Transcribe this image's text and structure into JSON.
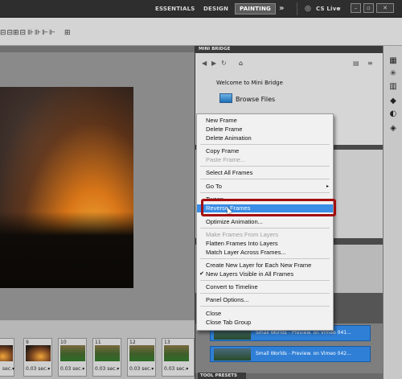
{
  "appbar": {
    "workspaces": [
      "ESSENTIALS",
      "DESIGN",
      "PAINTING"
    ],
    "more": "»",
    "cslive": "CS Live",
    "cslive_arrow": "▾"
  },
  "bridge": {
    "title": "MINI BRIDGE",
    "welcome": "Welcome to Mini Bridge",
    "browse": "Browse Files"
  },
  "menu": {
    "items": [
      {
        "label": "New Frame"
      },
      {
        "label": "Delete Frame"
      },
      {
        "label": "Delete Animation"
      },
      {
        "label": "Copy Frame"
      },
      {
        "label": "Paste Frame..."
      },
      {
        "label": "Select All Frames"
      },
      {
        "label": "Go To"
      },
      {
        "label": "Tween..."
      },
      {
        "label": "Reverse Frames"
      },
      {
        "label": "Optimize Animation..."
      },
      {
        "label": "Make Frames From Layers"
      },
      {
        "label": "Flatten Frames Into Layers"
      },
      {
        "label": "Match Layer Across Frames..."
      },
      {
        "label": "Create New Layer for Each New Frame"
      },
      {
        "label": "New Layers Visible in All Frames"
      },
      {
        "label": "Convert to Timeline"
      },
      {
        "label": "Panel Options..."
      },
      {
        "label": "Close"
      },
      {
        "label": "Close Tab Group"
      }
    ],
    "submenu_arrow": "▸",
    "checkmark": "✔"
  },
  "filmstrip": {
    "frames": [
      {
        "num": "",
        "time": "sec.▾"
      },
      {
        "num": "9",
        "time": "0.03 sec.▾"
      },
      {
        "num": "10",
        "time": "0.03 sec.▾"
      },
      {
        "num": "11",
        "time": "0.03 sec.▾"
      },
      {
        "num": "12",
        "time": "0.03 sec.▾"
      },
      {
        "num": "13",
        "time": "0.03 sec.▾"
      }
    ]
  },
  "animations": [
    {
      "title": "Small Worlds - Preview. on Vimeo 041..."
    },
    {
      "title": "Small Worlds - Preview. on Vimeo 042..."
    }
  ],
  "toolpresets": "TOOL PRESETS",
  "colors": {
    "highlight": "#3a8ee6",
    "callout": "#a40d0d",
    "panel_dark": "#3a3a3a"
  }
}
